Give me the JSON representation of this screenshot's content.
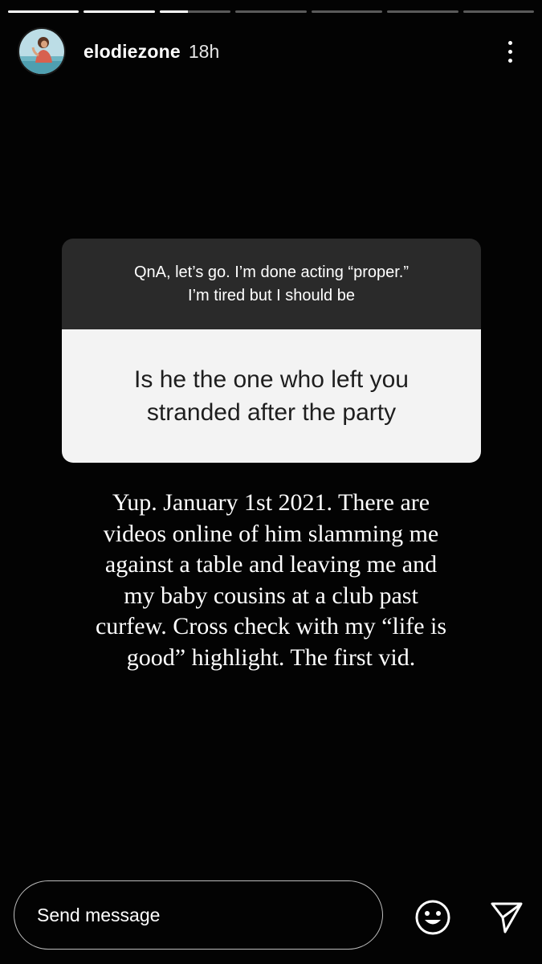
{
  "story": {
    "progress_segments": [
      1,
      1,
      0.4,
      0,
      0,
      0,
      0
    ],
    "username": "elodiezone",
    "timestamp": "18h"
  },
  "qna": {
    "prompt_lines": [
      "QnA, let’s go. I’m done acting “proper.”",
      "I’m tired but I should be"
    ],
    "question_lines": [
      "Is he the one who left you",
      "stranded after the party"
    ]
  },
  "answer": {
    "lines": [
      "Yup. January 1st 2021. There are",
      "videos online of him slamming me",
      "against a table and leaving me and",
      "my baby cousins at a club past",
      "curfew. Cross check with my “life is",
      "good” highlight. The first vid."
    ]
  },
  "footer": {
    "message_placeholder": "Send message"
  },
  "icons": {
    "more": "more-vertical-icon",
    "emoji": "emoji-icon",
    "send": "send-icon"
  }
}
